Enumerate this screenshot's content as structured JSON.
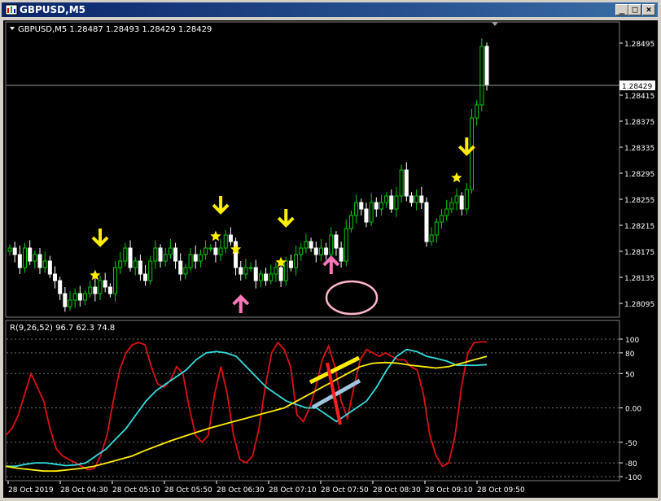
{
  "window": {
    "title": "GBPUSD,M5",
    "buttons": [
      "_",
      "□",
      "×"
    ]
  },
  "main_panel": {
    "header": "GBPUSD,M5  1.28487 1.28493 1.28429 1.28429",
    "price_scale": [
      "1.28495",
      "1.28415",
      "1.28375",
      "1.28335",
      "1.28295",
      "1.28255",
      "1.28215",
      "1.28175",
      "1.28135",
      "1.28095"
    ],
    "current_price": "1.28429"
  },
  "indicator_panel": {
    "header": "R(9,26,52) 96.7 62.3 74.8",
    "scale": [
      "100",
      "80",
      "50",
      "0.00",
      "-50",
      "-80",
      "-100"
    ]
  },
  "time_axis": [
    "28 Oct 2019",
    "28 Oct 04:30",
    "28 Oct 05:10",
    "28 Oct 05:50",
    "28 Oct 06:30",
    "28 Oct 07:10",
    "28 Oct 07:50",
    "28 Oct 08:30",
    "28 Oct 09:10",
    "28 Oct 09:50"
  ],
  "colors": {
    "bull": "#00cc00",
    "bear": "#ffffff",
    "fast": "#dd1111",
    "mid": "#33dddd",
    "slow": "#ffee00",
    "arrow_down": "#ffee00",
    "arrow_up": "#ff77bb",
    "star": "#ffee00",
    "grid": "#707070"
  },
  "chart_data": [
    {
      "type": "candlestick",
      "title": "GBPUSD,M5",
      "ohlc_header": [
        1.28487,
        1.28493,
        1.28429,
        1.28429
      ],
      "ylim": [
        1.2808,
        1.2852
      ],
      "x_labels": [
        "28 Oct 2019",
        "28 Oct 04:30",
        "28 Oct 05:10",
        "28 Oct 05:50",
        "28 Oct 06:30",
        "28 Oct 07:10",
        "28 Oct 07:50",
        "28 Oct 08:30",
        "28 Oct 09:10",
        "28 Oct 09:50"
      ],
      "close": [
        1.2818,
        1.2817,
        1.2815,
        1.2818,
        1.2816,
        1.2817,
        1.2815,
        1.2816,
        1.2814,
        1.2813,
        1.2811,
        1.2809,
        1.281,
        1.2811,
        1.281,
        1.2811,
        1.2812,
        1.2811,
        1.2813,
        1.2812,
        1.2811,
        1.2815,
        1.2816,
        1.2818,
        1.2815,
        1.2816,
        1.2814,
        1.2813,
        1.2816,
        1.2818,
        1.2816,
        1.2817,
        1.2818,
        1.2816,
        1.2814,
        1.2815,
        1.2817,
        1.2816,
        1.2817,
        1.2818,
        1.2818,
        1.2817,
        1.2818,
        1.282,
        1.2819,
        1.2815,
        1.2814,
        1.2815,
        1.2815,
        1.2813,
        1.2814,
        1.2813,
        1.2814,
        1.2815,
        1.2813,
        1.2816,
        1.2815,
        1.2817,
        1.2818,
        1.2819,
        1.2818,
        1.2817,
        1.2818,
        1.2817,
        1.282,
        1.2818,
        1.2816,
        1.2821,
        1.2823,
        1.2825,
        1.2824,
        1.2822,
        1.2825,
        1.2824,
        1.2825,
        1.2826,
        1.2824,
        1.2826,
        1.283,
        1.2826,
        1.2825,
        1.2826,
        1.2825,
        1.2819,
        1.282,
        1.2822,
        1.2823,
        1.2824,
        1.2825,
        1.2826,
        1.2824,
        1.2827,
        1.2838,
        1.284,
        1.2849,
        1.2843
      ],
      "series": [
        {
          "name": "R(9)"
        },
        {
          "name": "R(26)"
        },
        {
          "name": "R(52)"
        }
      ],
      "markers": [
        {
          "kind": "arrow-down",
          "bar": 18
        },
        {
          "kind": "star",
          "bar": 17
        },
        {
          "kind": "arrow-down",
          "bar": 42
        },
        {
          "kind": "star",
          "bar": 41
        },
        {
          "kind": "arrow-up",
          "bar": 46
        },
        {
          "kind": "star",
          "bar": 45
        },
        {
          "kind": "arrow-down",
          "bar": 55
        },
        {
          "kind": "star",
          "bar": 54
        },
        {
          "kind": "arrow-up",
          "bar": 64
        },
        {
          "kind": "arrow-down",
          "bar": 91
        },
        {
          "kind": "star",
          "bar": 89
        }
      ]
    },
    {
      "type": "line",
      "title": "R(9,26,52)",
      "ylim": [
        -100,
        100
      ],
      "series": [
        {
          "name": "R(9)",
          "values": [
            -40,
            -30,
            -10,
            20,
            50,
            30,
            10,
            -30,
            -60,
            -70,
            -75,
            -80,
            -85,
            -90,
            -88,
            -70,
            -40,
            10,
            55,
            80,
            92,
            95,
            92,
            60,
            35,
            30,
            40,
            60,
            50,
            0,
            -40,
            -50,
            -40,
            20,
            60,
            20,
            -40,
            -75,
            -80,
            -70,
            -30,
            30,
            80,
            95,
            85,
            60,
            -10,
            -20,
            0,
            30,
            70,
            90,
            60,
            10,
            -15,
            30,
            70,
            85,
            80,
            75,
            80,
            75,
            70,
            70,
            60,
            55,
            20,
            -40,
            -70,
            -85,
            -80,
            -40,
            30,
            80,
            95,
            96,
            96
          ]
        },
        {
          "name": "R(26)",
          "values": [
            -85,
            -85,
            -82,
            -80,
            -80,
            -82,
            -84,
            -83,
            -80,
            -70,
            -60,
            -45,
            -30,
            -10,
            10,
            25,
            35,
            45,
            55,
            70,
            80,
            82,
            80,
            75,
            60,
            45,
            30,
            20,
            10,
            5,
            0,
            0,
            -10,
            -20,
            -10,
            0,
            10,
            30,
            55,
            75,
            85,
            82,
            75,
            72,
            68,
            62,
            62,
            62,
            63
          ]
        },
        {
          "name": "R(52)",
          "values": [
            -85,
            -88,
            -90,
            -92,
            -92,
            -90,
            -88,
            -85,
            -80,
            -75,
            -70,
            -62,
            -55,
            -48,
            -42,
            -36,
            -30,
            -25,
            -20,
            -15,
            -10,
            -5,
            0,
            10,
            20,
            30,
            40,
            50,
            60,
            65,
            66,
            65,
            62,
            60,
            58,
            60,
            65,
            70,
            75
          ]
        }
      ],
      "header_values": [
        96.7,
        62.3,
        74.8
      ]
    }
  ]
}
